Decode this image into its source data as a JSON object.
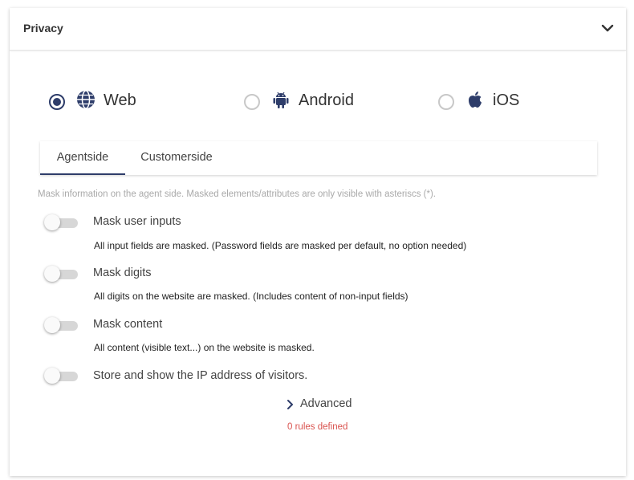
{
  "panel": {
    "title": "Privacy",
    "collapse_icon": "chevron-down-icon"
  },
  "platforms": [
    {
      "label": "Web",
      "icon": "globe-icon",
      "selected": true
    },
    {
      "label": "Android",
      "icon": "android-icon",
      "selected": false
    },
    {
      "label": "iOS",
      "icon": "apple-icon",
      "selected": false
    }
  ],
  "tabs": [
    {
      "label": "Agentside",
      "active": true
    },
    {
      "label": "Customerside",
      "active": false
    }
  ],
  "hint": "Mask information on the agent side. Masked elements/attributes are only visible with asteriscs (*).",
  "options": [
    {
      "label": "Mask user inputs",
      "description": "All input fields are masked. (Password fields are masked per default, no option needed)",
      "enabled": false
    },
    {
      "label": "Mask digits",
      "description": "All digits on the website are masked. (Includes content of non-input fields)",
      "enabled": false
    },
    {
      "label": "Mask content",
      "description": "All content (visible text...) on the website is masked.",
      "enabled": false
    },
    {
      "label": "Store and show the IP address of visitors.",
      "description": "",
      "enabled": false
    }
  ],
  "advanced": {
    "label": "Advanced",
    "icon": "chevron-right-icon",
    "rules_text": "0 rules defined"
  },
  "colors": {
    "accent": "#2e3d6a",
    "warning": "#d9534f",
    "hint": "#a9a9a9"
  }
}
